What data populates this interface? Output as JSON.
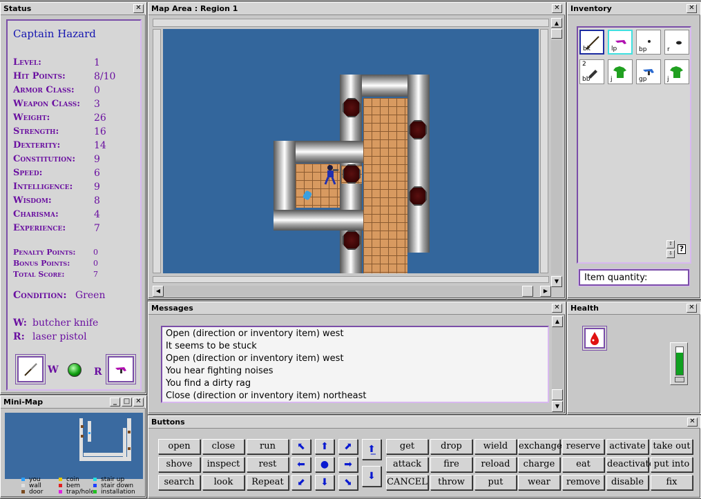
{
  "status": {
    "title": "Status",
    "name": "Captain Hazard",
    "stats": [
      {
        "label": "Level:",
        "value": "1"
      },
      {
        "label": "Hit Points:",
        "value": "8/10"
      },
      {
        "label": "Armor Class:",
        "value": "0"
      },
      {
        "label": "Weapon Class:",
        "value": "3"
      },
      {
        "label": "Weight:",
        "value": "26"
      },
      {
        "label": "Strength:",
        "value": "16"
      },
      {
        "label": "Dexterity:",
        "value": "14"
      },
      {
        "label": "Constitution:",
        "value": "9"
      },
      {
        "label": "Speed:",
        "value": "6"
      },
      {
        "label": "Intelligence:",
        "value": "9"
      },
      {
        "label": "Wisdom:",
        "value": "8"
      },
      {
        "label": "Charisma:",
        "value": "4"
      },
      {
        "label": "Experience:",
        "value": "7"
      }
    ],
    "points": [
      {
        "label": "Penalty Points:",
        "value": "0"
      },
      {
        "label": "Bonus Points:",
        "value": "0"
      },
      {
        "label": "Total Score:",
        "value": "7"
      }
    ],
    "condition_label": "Condition:",
    "condition_value": "Green",
    "weapon_label": "W:",
    "weapon_value": "butcher knife",
    "ranged_label": "R:",
    "ranged_value": "laser pistol",
    "slot_w": "W",
    "slot_r": "R"
  },
  "map": {
    "title": "Map Area : Region 1"
  },
  "inventory": {
    "title": "Inventory",
    "items": [
      {
        "label": "bk",
        "count": ""
      },
      {
        "label": "lp",
        "count": ""
      },
      {
        "label": "bp",
        "count": ""
      },
      {
        "label": "r",
        "count": ""
      },
      {
        "label": "bb",
        "count": "2"
      },
      {
        "label": "j",
        "count": ""
      },
      {
        "label": "gp",
        "count": ""
      },
      {
        "label": "j",
        "count": ""
      }
    ],
    "quantity_label": "Item quantity:",
    "help": "?"
  },
  "messages": {
    "title": "Messages",
    "lines": [
      "Open (direction or inventory item) west",
      "It seems to be stuck",
      "Open (direction or inventory item) west",
      "You hear fighting noises",
      "You find a dirty rag",
      "Close (direction or inventory item) northeast"
    ]
  },
  "health": {
    "title": "Health"
  },
  "minimap": {
    "title": "Mini-Map",
    "legend": [
      {
        "label": "you",
        "color": "#2aa0ff"
      },
      {
        "label": "coin",
        "color": "#e8c800"
      },
      {
        "label": "stair up",
        "color": "#20e0e0"
      },
      {
        "label": "wall",
        "color": "#e0e0e0"
      },
      {
        "label": "bem",
        "color": "#e02020"
      },
      {
        "label": "stair down",
        "color": "#2040ff"
      },
      {
        "label": "door",
        "color": "#7a4a20"
      },
      {
        "label": "trap/hole",
        "color": "#e020e0"
      },
      {
        "label": "installation",
        "color": "#20c020"
      }
    ]
  },
  "buttons": {
    "title": "Buttons",
    "col1": [
      "open",
      "shove",
      "search"
    ],
    "col2": [
      "close",
      "inspect",
      "look"
    ],
    "col3": [
      "run",
      "rest",
      "Repeat"
    ],
    "col4": [
      "get",
      "attack",
      "CANCEL"
    ],
    "col5": [
      "drop",
      "fire",
      "throw"
    ],
    "col6": [
      "wield",
      "reload",
      "put"
    ],
    "col7": [
      "exchange",
      "charge",
      "wear"
    ],
    "col8": [
      "reserve",
      "eat",
      "remove"
    ],
    "col9": [
      "activate",
      "deactivate",
      "disable"
    ],
    "col10": [
      "take out",
      "put into",
      "fix"
    ]
  }
}
